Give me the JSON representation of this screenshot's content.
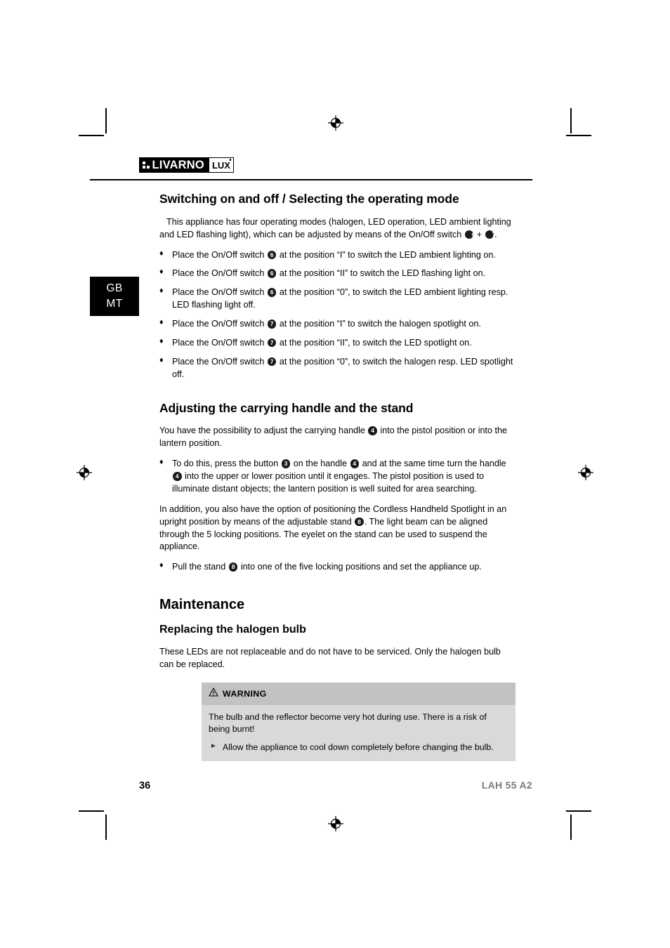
{
  "brand": {
    "name": "LIVARNO",
    "sub": "LUX"
  },
  "language_tab": {
    "line1": "GB",
    "line2": "MT"
  },
  "sections": {
    "switching": {
      "heading": "Switching on and off / Selecting the operating mode",
      "intro": "This appliance has four operating modes (halogen, LED operation, LED ambient lighting and LED flashing light), which can be adjusted by means of the On/Off switch",
      "intro_ref_a": "6",
      "intro_plus": "+",
      "intro_ref_b": "7",
      "intro_end": ".",
      "bullets": [
        {
          "pre": "Place the On/Off switch",
          "ref": "6",
          "post": "at the position “I” to switch the LED ambient lighting on."
        },
        {
          "pre": "Place the On/Off switch",
          "ref": "6",
          "post": "at the position “II” to switch the LED flashing light on."
        },
        {
          "pre": "Place the On/Off switch",
          "ref": "6",
          "post": "at the position “0”, to switch the LED ambient lighting resp. LED flashing light off."
        },
        {
          "pre": "Place the On/Off switch",
          "ref": "7",
          "post": "at the position “I” to switch the halogen spotlight on."
        },
        {
          "pre": "Place the On/Off switch",
          "ref": "7",
          "post": "at the position “II”, to switch the LED spotlight on."
        },
        {
          "pre": "Place the On/Off switch",
          "ref": "7",
          "post": "at the position “0”, to switch the halogen resp. LED spotlight off."
        }
      ]
    },
    "handle": {
      "heading": "Adjusting the carrying handle and the stand",
      "intro_pre": "You have the possibility to adjust the carrying handle",
      "intro_ref": "4",
      "intro_post": "into the pistol position or into the lantern position.",
      "bullet1_pre": "To do this, press the button",
      "bullet1_ref1": "3",
      "bullet1_mid": "on the handle",
      "bullet1_ref2": "4",
      "bullet1_mid2": "and at the same time turn the handle",
      "bullet1_ref3": "4",
      "bullet1_post": "into the upper or lower position until it engages. The pistol position is used to illuminate distant objects; the lantern position is well suited for area searching.",
      "para2_pre": "In addition, you also have the option of positioning the Cordless Handheld Spotlight in an upright position by means of the adjustable stand",
      "para2_ref": "8",
      "para2_post": ". The light beam can be aligned through the 5 locking positions. The eyelet on the stand can be used to suspend the appliance.",
      "bullet2_pre": "Pull the stand",
      "bullet2_ref": "8",
      "bullet2_post": "into one of the five locking positions and set the appliance up."
    },
    "maintenance": {
      "heading": "Maintenance",
      "sub_heading": "Replacing the halogen bulb",
      "intro": "These LEDs are not replaceable and do not have to be serviced. Only the halogen bulb can be replaced.",
      "warning": {
        "title": "WARNING",
        "text": "The bulb and the reflector become very hot during use. There is a risk of being burnt!",
        "action": "Allow the appliance to cool down completely before changing the bulb."
      }
    }
  },
  "footer": {
    "page_number": "36",
    "model": "LAH 55 A2"
  },
  "icons": {
    "bullet_diamond": "♦",
    "bullet_triangle": "►"
  },
  "colors": {
    "warning_header_bg": "#c2c2c2",
    "warning_body_bg": "#d9d9d9",
    "model_text": "#7a7a7a",
    "ink": "#000000"
  }
}
